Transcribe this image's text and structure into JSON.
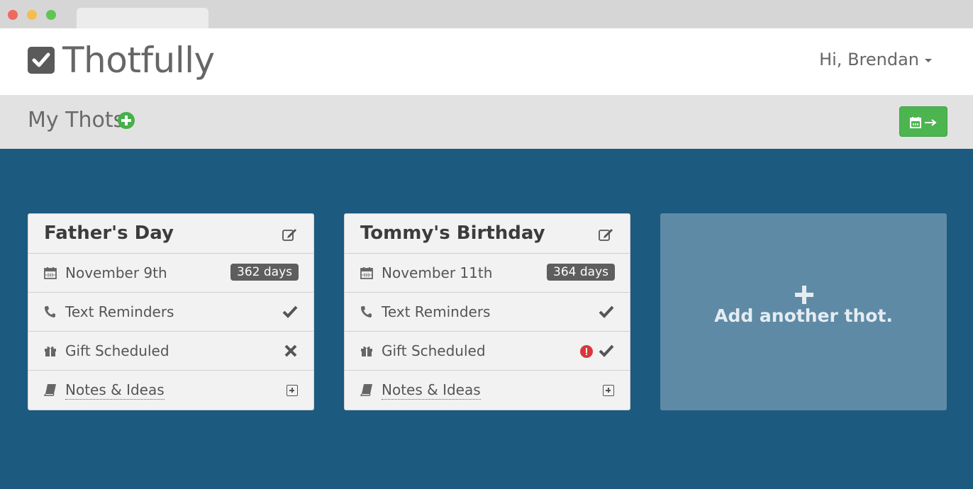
{
  "app": {
    "name": "Thotfully"
  },
  "header": {
    "greeting": "Hi, Brendan"
  },
  "subheader": {
    "title": "My Thots"
  },
  "colors": {
    "brand_green": "#4cb550",
    "background_blue": "#1c5a80",
    "warning_red": "#d9383a"
  },
  "thots": [
    {
      "title": "Father's Day",
      "date": "November 9th",
      "days_left": "362 days",
      "text_reminders": {
        "label": "Text Reminders",
        "status": "check"
      },
      "gift_scheduled": {
        "label": "Gift Scheduled",
        "status": "x",
        "warning": false
      },
      "notes": {
        "label": "Notes & Ideas"
      }
    },
    {
      "title": "Tommy's Birthday",
      "date": "November 11th",
      "days_left": "364 days",
      "text_reminders": {
        "label": "Text Reminders",
        "status": "check"
      },
      "gift_scheduled": {
        "label": "Gift Scheduled",
        "status": "check",
        "warning": true
      },
      "notes": {
        "label": "Notes & Ideas"
      }
    }
  ],
  "add_card": {
    "label": "Add another thot."
  },
  "icons": {
    "logo": "checkbox-icon",
    "add": "plus-circle-icon",
    "export": "calendar-arrow-icon",
    "edit": "edit-icon",
    "date": "calendar-icon",
    "reminders": "phone-icon",
    "gift": "gift-icon",
    "notes": "book-icon"
  }
}
